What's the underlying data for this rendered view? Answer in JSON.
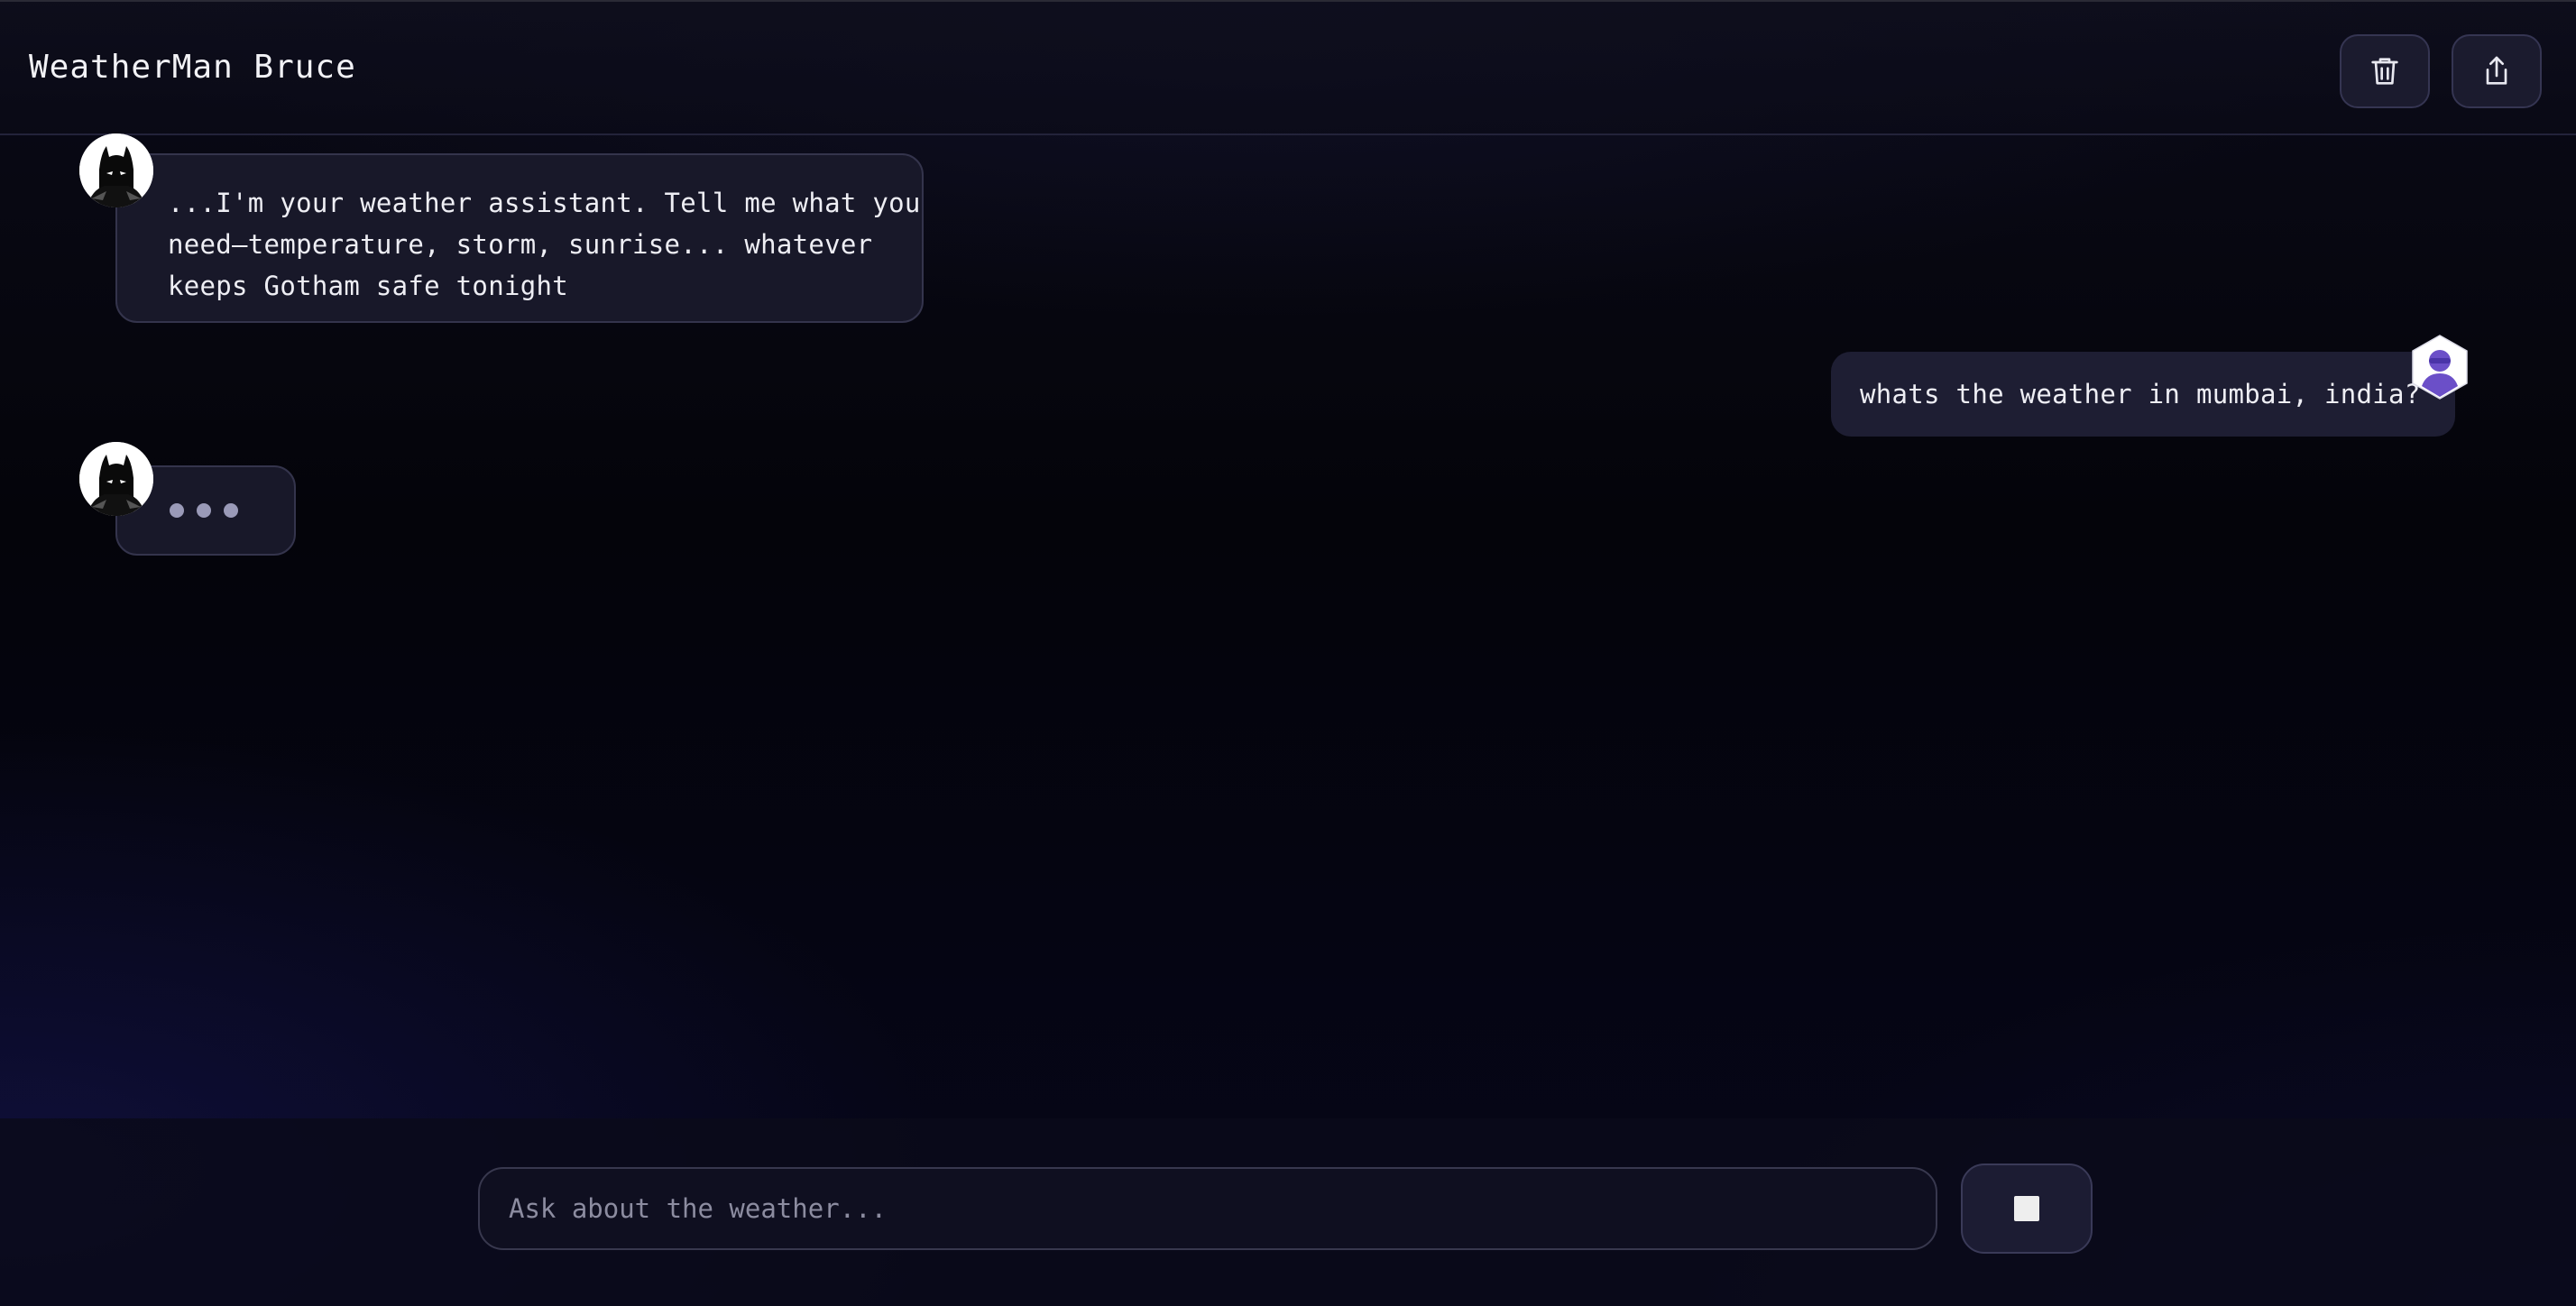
{
  "header": {
    "title": "WeatherMan Bruce",
    "delete_icon": "trash-icon",
    "share_icon": "share-icon"
  },
  "messages": [
    {
      "role": "assistant",
      "avatar": "batman-avatar",
      "lines": [
        "...I'm your weather assistant. Tell me what you",
        "need—temperature, storm, sunrise... whatever",
        "keeps Gotham safe tonight"
      ]
    },
    {
      "role": "user",
      "avatar": "user-avatar",
      "text": "whats the weather in mumbai, india?"
    },
    {
      "role": "assistant",
      "avatar": "batman-avatar",
      "typing": true
    }
  ],
  "composer": {
    "placeholder": "Ask about the weather...",
    "value": "",
    "stop_icon": "stop-icon"
  },
  "colors": {
    "background": "#05050c",
    "bubble": "#181829",
    "user_bubble": "#1e1e33",
    "accent_purple": "#6b4fc8"
  }
}
